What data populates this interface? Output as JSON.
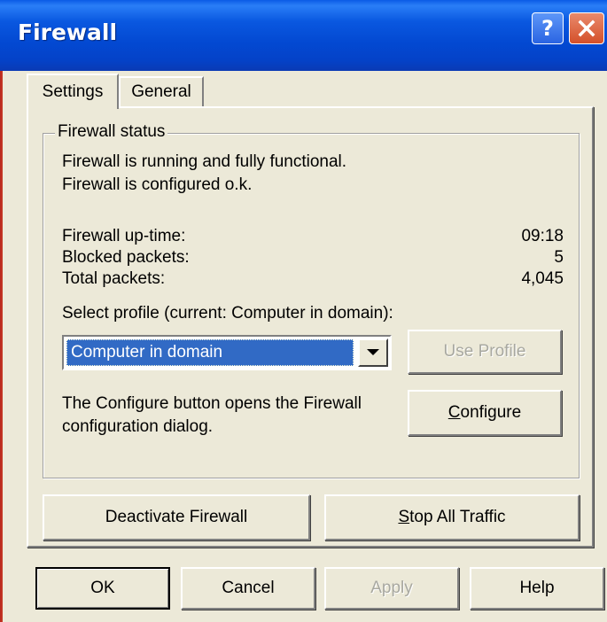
{
  "window": {
    "title": "Firewall"
  },
  "tabs": [
    {
      "label": "Settings",
      "active": true
    },
    {
      "label": "General",
      "active": false
    }
  ],
  "status_group": {
    "legend": "Firewall status",
    "line1": "Firewall is running and fully functional.",
    "line2": "Firewall is configured o.k."
  },
  "stats": {
    "uptime_label": "Firewall up-time:",
    "uptime_value": "09:18",
    "blocked_label": "Blocked packets:",
    "blocked_value": "5",
    "total_label": "Total packets:",
    "total_value": "4,045"
  },
  "profile": {
    "label": "Select profile (current: Computer in domain):",
    "selected": "Computer in domain",
    "use_button": "Use Profile"
  },
  "configure": {
    "description_line1": "The Configure button opens the Firewall",
    "description_line2": "configuration dialog.",
    "button": "Configure"
  },
  "actions": {
    "deactivate": "Deactivate Firewall",
    "stop_all": "Stop All Traffic"
  },
  "footer": {
    "ok": "OK",
    "cancel": "Cancel",
    "apply": "Apply",
    "help": "Help"
  },
  "colors": {
    "titlebar": "#0a58e0",
    "selection": "#316ac5",
    "dialog_bg": "#ece9d8"
  }
}
